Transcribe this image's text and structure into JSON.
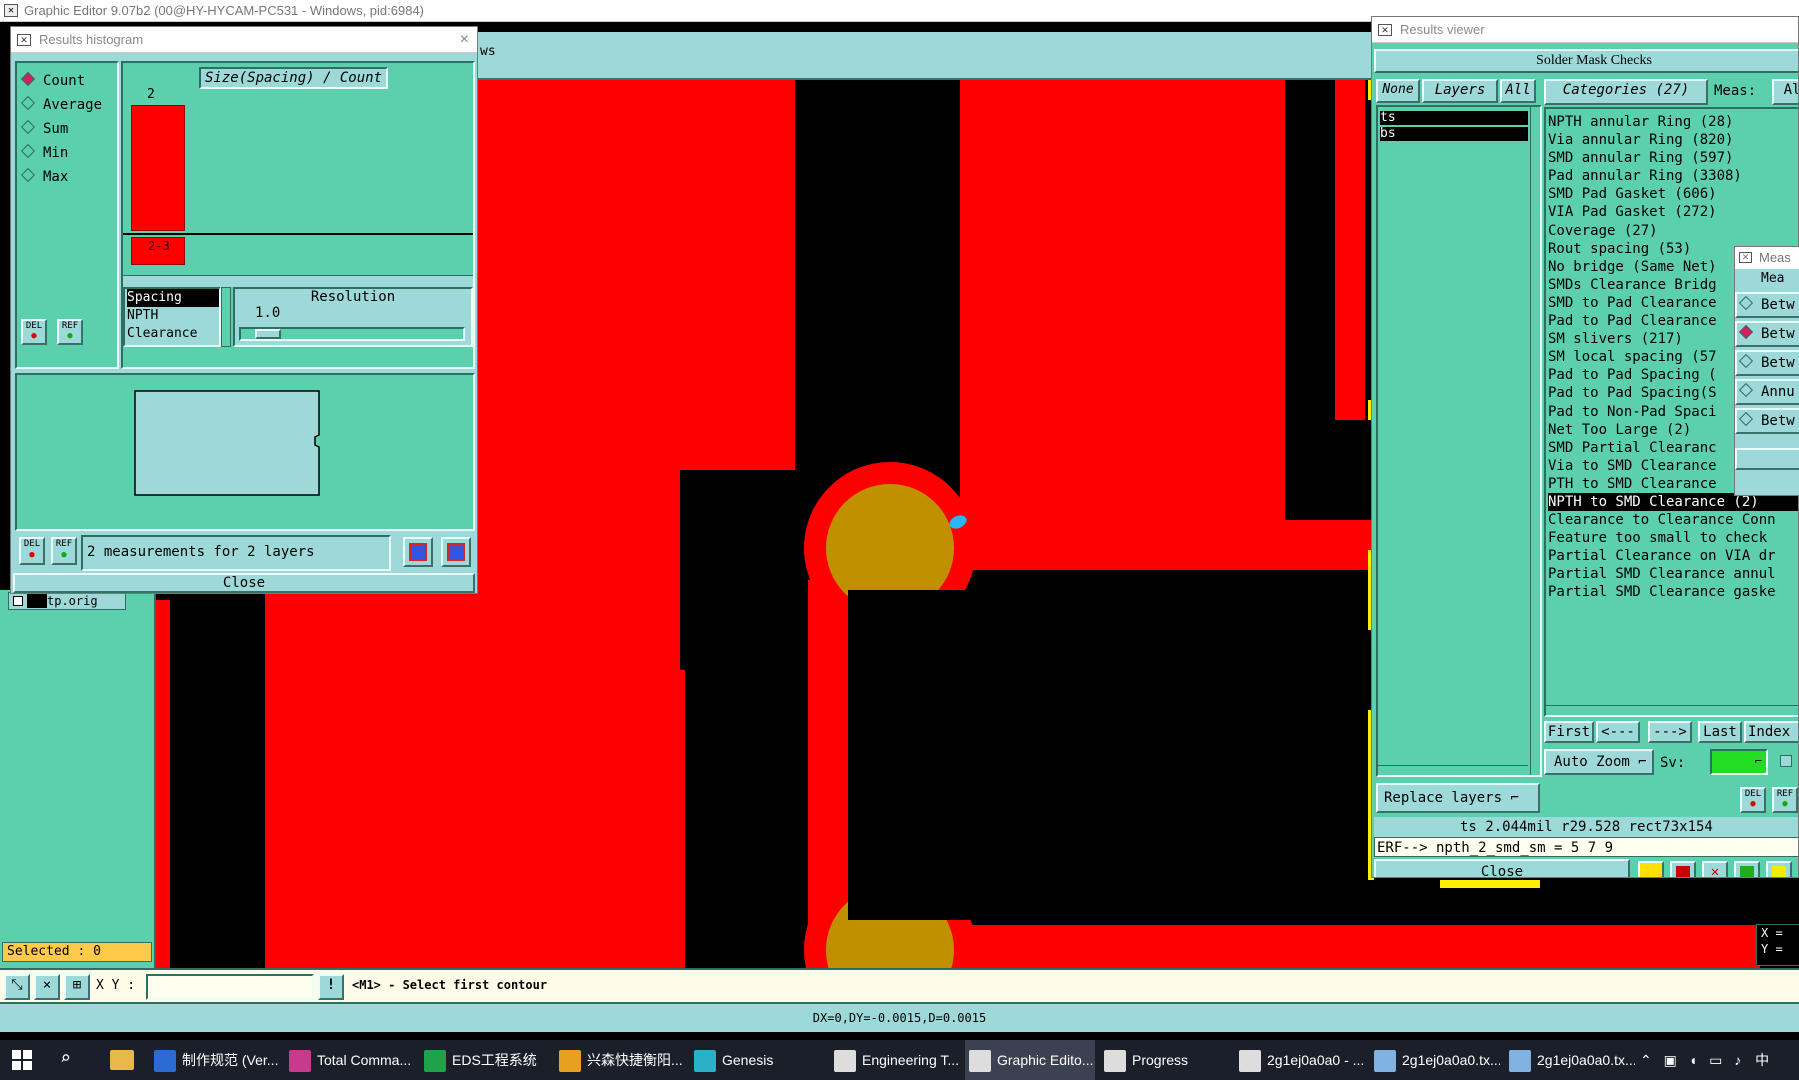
{
  "app": {
    "title": "Graphic Editor 9.07b2 (00@HY-HYCAM-PC531 - Windows, pid:6984)",
    "menu_fragment": "ws",
    "layer_label": "tp.orig",
    "selected_label": "Selected : 0",
    "xy_label": "X Y :",
    "xy_value": "",
    "prompt": "<M1> - Select first contour",
    "status": "DX=0,DY=-0.0015,D=0.0015",
    "corner_x": "X =",
    "corner_y": "Y ="
  },
  "histogram": {
    "title": "Results histogram",
    "modes": [
      "Count",
      "Average",
      "Sum",
      "Min",
      "Max"
    ],
    "selected_mode": "Count",
    "chart_title": "Size(Spacing) / Count",
    "bar_count": "2",
    "bar_range": "2-3",
    "types": [
      "Spacing",
      "NPTH",
      "Clearance"
    ],
    "resolution_label": "Resolution",
    "resolution_value": "1.0",
    "del_label": "DEL",
    "ref_label": "REF",
    "measurement_text": "2 measurements for 2 layers",
    "close_label": "Close",
    "chart_data": {
      "type": "bar",
      "categories": [
        "2-3"
      ],
      "values": [
        2
      ],
      "title": "Size(Spacing) / Count"
    }
  },
  "results": {
    "title": "Results viewer",
    "header": "Solder Mask Checks",
    "none_label": "None",
    "layers_label": "Layers",
    "all_label": "All",
    "categories_label": "Categories (27)",
    "meas_label": "Meas:",
    "meas_all": "Al",
    "layers": [
      "ts",
      "bs"
    ],
    "categories": [
      "NPTH annular Ring (28)",
      "Via annular Ring (820)",
      "SMD annular Ring (597)",
      "Pad annular Ring (3308)",
      "SMD Pad Gasket (606)",
      "VIA Pad Gasket (272)",
      "Coverage (27)",
      "Rout spacing (53)",
      "No bridge (Same Net)",
      "SMDs Clearance Bridg",
      "SMD to Pad Clearance",
      "Pad to Pad Clearance",
      "SM slivers (217)",
      "SM local spacing (57",
      "Pad to Pad Spacing (",
      "Pad to Pad Spacing(S",
      "Pad to Non-Pad Spaci",
      "Net Too Large (2)",
      "SMD Partial Clearanc",
      "Via to SMD Clearance",
      "PTH to SMD Clearance",
      "NPTH to SMD Clearance (2)",
      "Clearance to Clearance Conn",
      "Feature too small to check",
      "Partial Clearance on VIA dr",
      "Partial SMD Clearance annul",
      "Partial SMD Clearance gaske"
    ],
    "selected_category": "NPTH to SMD Clearance (2)",
    "first_label": "First",
    "prev_label": "<---",
    "next_label": "--->",
    "last_label": "Last",
    "index_label": "Index",
    "autozoom_label": "Auto Zoom",
    "sv_label": "Sv:",
    "replace_label": "Replace layers",
    "info_line": "ts 2.044mil  r29.528  rect73x154",
    "erf_line": "ERF--> npth_2_smd_sm = 5 7 9",
    "close_label": "Close",
    "sv_color": "#22dd22"
  },
  "meas_popup": {
    "title": "Meas",
    "header": "Mea",
    "items": [
      "Betw",
      "Betw",
      "Betw",
      "Annu",
      "Betw"
    ],
    "selected_index": 1
  },
  "taskbar": {
    "items": [
      {
        "label": "制作规范 (Ver...",
        "icon": "doc-icon",
        "color": "#2b6cd4"
      },
      {
        "label": "Total Comma...",
        "icon": "floppy-icon",
        "color": "#c83a8c"
      },
      {
        "label": "EDS工程系统",
        "icon": "f-icon",
        "color": "#1fa34a"
      },
      {
        "label": "兴森快捷衡阳...",
        "icon": "shell-icon",
        "color": "#e8a020"
      },
      {
        "label": "Genesis",
        "icon": "eye-icon",
        "color": "#2ab0c8"
      },
      {
        "label": "Engineering T...",
        "icon": "x-window-icon",
        "color": "#dddddd"
      },
      {
        "label": "Graphic Edito...",
        "icon": "x-window-icon",
        "color": "#dddddd"
      },
      {
        "label": "Progress",
        "icon": "x-window-icon",
        "color": "#dddddd"
      },
      {
        "label": "2g1ej0a0a0 - ...",
        "icon": "x-window-icon",
        "color": "#dddddd"
      },
      {
        "label": "2g1ej0a0a0.tx...",
        "icon": "notepad-icon",
        "color": "#7fb2e0"
      },
      {
        "label": "2g1ej0a0a0.tx...",
        "icon": "notepad-icon",
        "color": "#7fb2e0"
      }
    ],
    "tray_text": "中",
    "colors": {
      "bar": "#1b1f2a",
      "active": "#3a4150"
    }
  },
  "colors": {
    "copper": "#ff0000",
    "pad": "#c09000",
    "teal": "#5ccfac",
    "panel": "#9dd9d8",
    "marker": "#29b6f6",
    "yellow": "#ffee00"
  }
}
